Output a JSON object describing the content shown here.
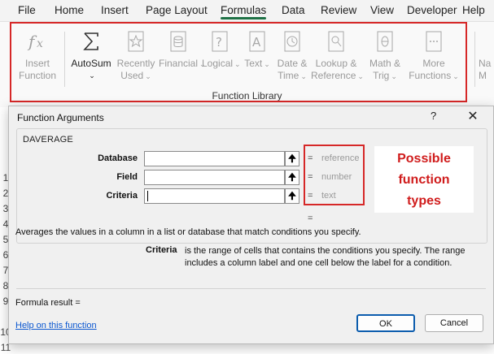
{
  "menu": [
    "File",
    "Home",
    "Insert",
    "Page Layout",
    "Formulas",
    "Data",
    "Review",
    "View",
    "Developer",
    "Help"
  ],
  "ribbon": {
    "buttons": [
      {
        "icon": "fx-icon",
        "label1": "Insert",
        "label2": "Function",
        "chevron": ""
      },
      {
        "icon": "sigma-icon",
        "label1": "AutoSum",
        "label2": "",
        "chevron": "⌄"
      },
      {
        "icon": "star-icon",
        "label1": "Recently",
        "label2": "Used",
        "chevron": "⌄"
      },
      {
        "icon": "database-icon",
        "label1": "Financial",
        "label2": "",
        "chevron": "⌄"
      },
      {
        "icon": "question-icon",
        "label1": "Logical",
        "label2": "",
        "chevron": "⌄"
      },
      {
        "icon": "text-a-icon",
        "label1": "Text",
        "label2": "",
        "chevron": "⌄"
      },
      {
        "icon": "clock-icon",
        "label1": "Date &",
        "label2": "Time",
        "chevron": "⌄"
      },
      {
        "icon": "magnifier-icon",
        "label1": "Lookup &",
        "label2": "Reference",
        "chevron": "⌄"
      },
      {
        "icon": "theta-icon",
        "label1": "Math &",
        "label2": "Trig",
        "chevron": "⌄"
      },
      {
        "icon": "book-icon",
        "label1": "More",
        "label2": "Functions",
        "chevron": "⌄"
      }
    ],
    "group_caption": "Function Library",
    "partial_button": "Na\nM"
  },
  "rows": [
    "1",
    "2",
    "3",
    "4",
    "5",
    "6",
    "7",
    "8",
    "9",
    "10",
    "11"
  ],
  "dialog": {
    "title": "Function Arguments",
    "help": "?",
    "close": "✕",
    "function_name": "DAVERAGE",
    "args": [
      {
        "label": "Database",
        "value": "",
        "eq": "=",
        "type": "reference"
      },
      {
        "label": "Field",
        "value": "",
        "eq": "=",
        "type": "number"
      },
      {
        "label": "Criteria",
        "value": "",
        "eq": "=",
        "type": "text"
      }
    ],
    "result_eq": "=",
    "description": "Averages the values in a column in a list or database that match conditions you specify.",
    "arg_help_name": "Criteria",
    "arg_help_text": "is the range of cells that contains the conditions you specify. The range includes a column label and one cell below the label for a condition.",
    "formula_result": "Formula result =",
    "help_link": "Help on this function",
    "ok": "OK",
    "cancel": "Cancel"
  },
  "annotation": {
    "lines": [
      "Possible",
      "function",
      "types"
    ],
    "color": "#d62828"
  }
}
